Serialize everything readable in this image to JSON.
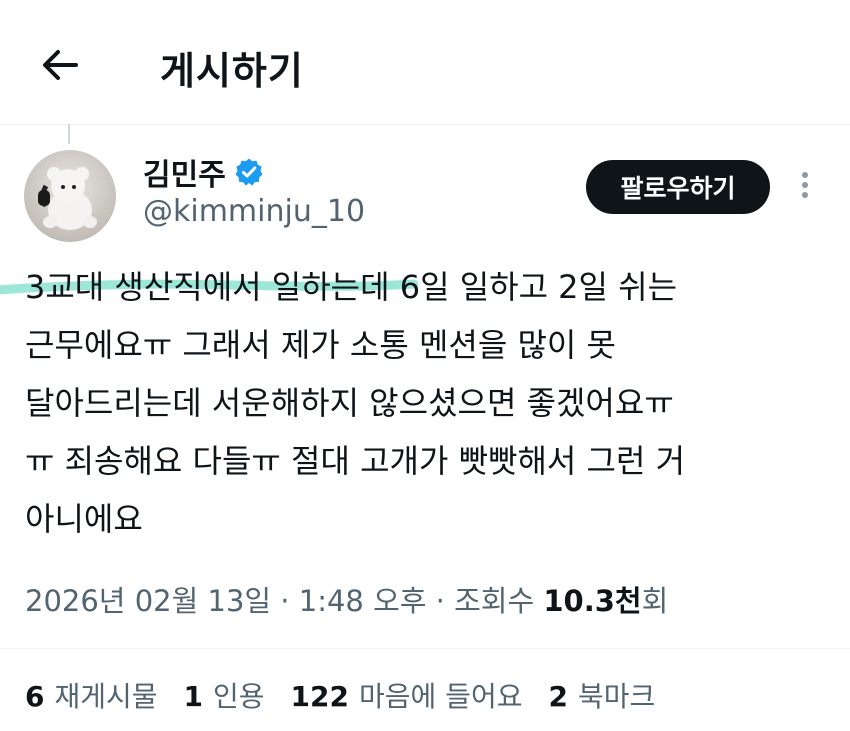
{
  "header": {
    "title": "게시하기",
    "back_icon": "arrow-left-icon"
  },
  "author": {
    "display_name": "김민주",
    "handle": "@kimminju_10",
    "verified": true,
    "verified_color": "#1d9bf0",
    "follow_label": "팔로우하기"
  },
  "tweet": {
    "text_highlighted": "3교대 생산직에서 일하는데",
    "text_rest": " 6일 일하고 2일 쉬는\n근무에요ㅠ 그래서 제가 소통 멘션을 많이 못\n달아드리는데 서운해하지 않으셨으면 좋겠어요ㅠ\nㅠ 죄송해요 다들ㅠ 절대 고개가 빳빳해서 그런 거\n아니에요",
    "highlight_color": "#7fe0d0"
  },
  "meta": {
    "timestamp": "2026년 02월 13일 · 1:48 오후 · 조회수 ",
    "views_count": "10.3천",
    "views_suffix": "회"
  },
  "stats": {
    "reposts_count": "6",
    "reposts_label": "재게시물",
    "quotes_count": "1",
    "quotes_label": "인용",
    "likes_count": "122",
    "likes_label": "마음에 들어요",
    "bookmarks_count": "2",
    "bookmarks_label": "북마크"
  }
}
